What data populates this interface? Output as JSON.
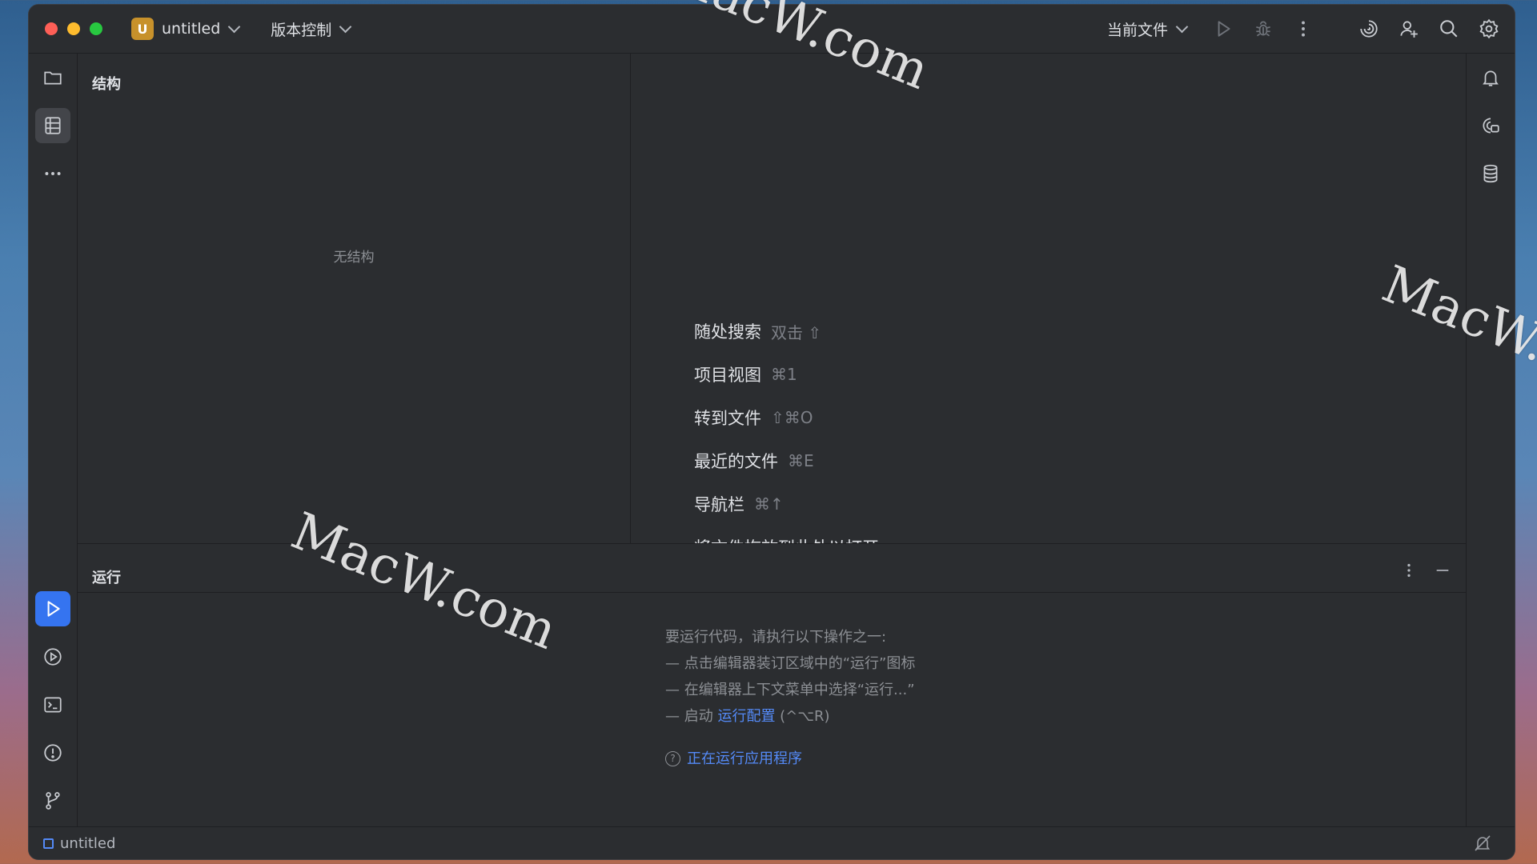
{
  "window": {
    "project_badge": "U",
    "project_name": "untitled",
    "vcs_label": "版本控制",
    "run_config_label": "当前文件"
  },
  "structure_panel": {
    "title": "结构",
    "empty_text": "无结构"
  },
  "editor_hints": [
    {
      "label": "随处搜索",
      "shortcut": "双击 ⇧"
    },
    {
      "label": "项目视图",
      "shortcut": "⌘1"
    },
    {
      "label": "转到文件",
      "shortcut": "⇧⌘O"
    },
    {
      "label": "最近的文件",
      "shortcut": "⌘E"
    },
    {
      "label": "导航栏",
      "shortcut": "⌘↑"
    },
    {
      "label": "将文件拖放到此处以打开",
      "shortcut": ""
    }
  ],
  "run_panel": {
    "title": "运行",
    "intro": "要运行代码，请执行以下操作之一:",
    "option1": "— 点击编辑器装订区域中的“运行”图标",
    "option2": "— 在编辑器上下文菜单中选择“运行...”",
    "option3_prefix": "— 启动 ",
    "option3_link": "运行配置",
    "option3_suffix": " (^⌥R)",
    "help_link": "正在运行应用程序"
  },
  "statusbar": {
    "project": "untitled"
  },
  "watermarks": {
    "top": "MacW.com",
    "right": "MacW.co",
    "middle": "MacW.com"
  },
  "colors": {
    "accent": "#3574f0",
    "link": "#548af7",
    "badge": "#c7912b"
  }
}
